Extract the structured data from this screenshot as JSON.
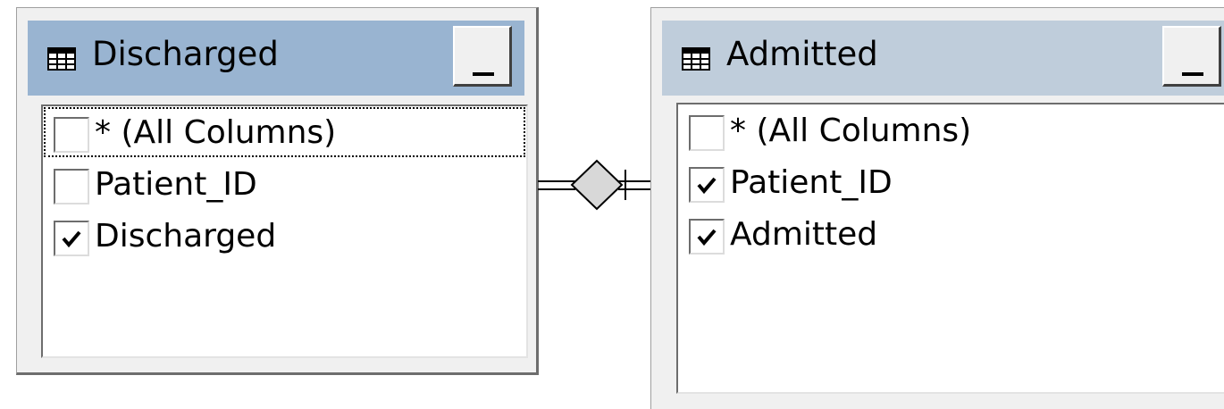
{
  "tables": [
    {
      "title": "Discharged",
      "title_icon": "table-grid-icon",
      "minimize_icon": "minimize-icon",
      "columns": [
        {
          "label": "* (All Columns)",
          "checked": false,
          "focused": true
        },
        {
          "label": "Patient_ID",
          "checked": false,
          "focused": false
        },
        {
          "label": "Discharged",
          "checked": true,
          "focused": false
        }
      ]
    },
    {
      "title": "Admitted",
      "title_icon": "table-grid-icon",
      "minimize_icon": "minimize-icon",
      "columns": [
        {
          "label": "* (All Columns)",
          "checked": false,
          "focused": false
        },
        {
          "label": "Patient_ID",
          "checked": true,
          "focused": false
        },
        {
          "label": "Admitted",
          "checked": true,
          "focused": false
        }
      ]
    }
  ],
  "join": {
    "icon": "join-diamond-icon",
    "type": "inner-join"
  },
  "colors": {
    "active_titlebar": "#99b4d1",
    "inactive_titlebar": "#bfcddb",
    "window_background": "#f0f0f0"
  }
}
